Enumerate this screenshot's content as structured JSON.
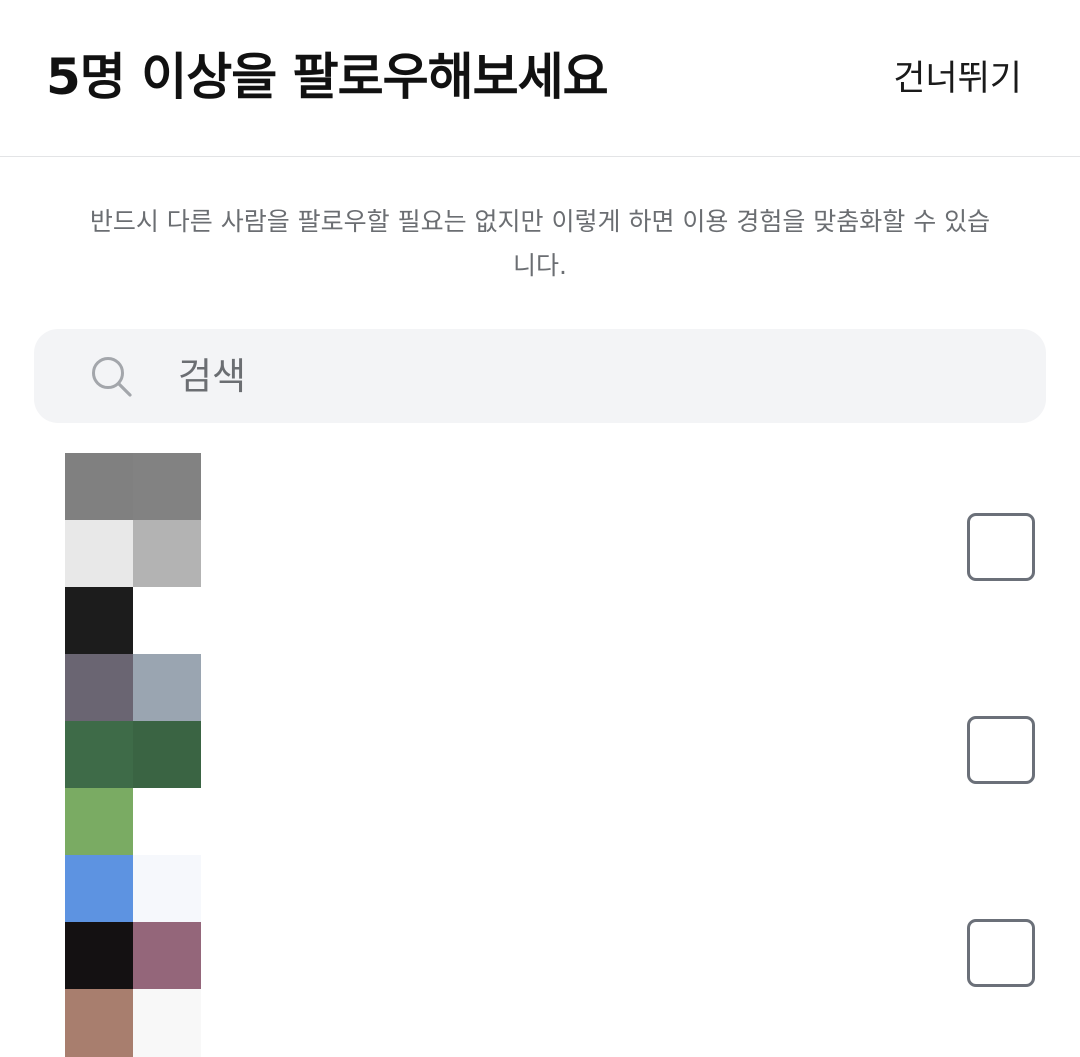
{
  "header": {
    "title": "5명 이상을 팔로우해보세요",
    "skip_label": "건너뛰기"
  },
  "description": "반드시 다른 사람을 팔로우할 필요는 없지만 이렇게 하면 이용 경험을 맞춤화할 수 있습니다.",
  "search": {
    "placeholder": "검색",
    "value": "",
    "icon": "search-icon"
  },
  "suggestions": [
    {
      "checked": false
    },
    {
      "checked": false
    },
    {
      "checked": false
    }
  ],
  "colors": {
    "header_divider": "#e3e4e6",
    "search_background": "#f3f4f6",
    "muted_text": "#6b6e72",
    "checkbox_border": "#6b7079",
    "mosaic": [
      [
        "#808080",
        "#828282"
      ],
      [
        "#e8e8e8",
        "#b3b3b3"
      ],
      [
        "#1c1c1c",
        "#ffffff"
      ],
      [
        "#6a6572",
        "#9aa5b1"
      ],
      [
        "#3e6b48",
        "#3a6443"
      ],
      [
        "#7aab63",
        "#ffffff"
      ],
      [
        "#5d93e1",
        "#f6f8fc"
      ],
      [
        "#141112",
        "#94667a"
      ],
      [
        "#a87e6e",
        "#f8f8f8"
      ]
    ]
  }
}
